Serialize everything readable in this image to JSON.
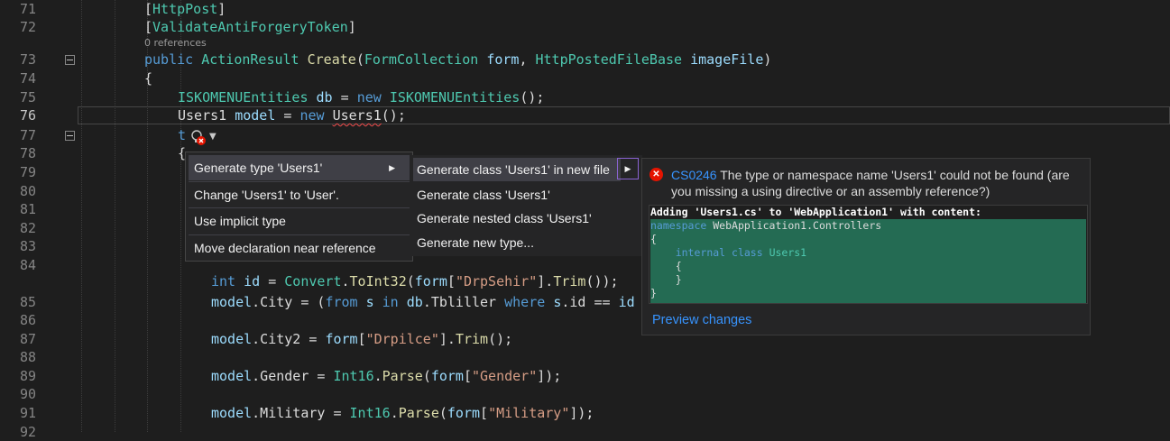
{
  "code_lines": [
    {
      "num": "71",
      "segments": [
        {
          "t": "[",
          "c": ""
        },
        {
          "t": "HttpPost",
          "c": "ty"
        },
        {
          "t": "]",
          "c": ""
        }
      ]
    },
    {
      "num": "72",
      "segments": [
        {
          "t": "[",
          "c": ""
        },
        {
          "t": "ValidateAntiForgeryToken",
          "c": "ty"
        },
        {
          "t": "]",
          "c": ""
        }
      ]
    },
    {
      "num": "73",
      "segments": [
        {
          "t": "public ",
          "c": "kw"
        },
        {
          "t": "ActionResult ",
          "c": "ty"
        },
        {
          "t": "Create",
          "c": "fn"
        },
        {
          "t": "(",
          "c": ""
        },
        {
          "t": "FormCollection ",
          "c": "ty"
        },
        {
          "t": "form",
          "c": "var"
        },
        {
          "t": ", ",
          "c": ""
        },
        {
          "t": "HttpPostedFileBase ",
          "c": "ty"
        },
        {
          "t": "imageFile",
          "c": "var"
        },
        {
          "t": ")",
          "c": ""
        }
      ]
    },
    {
      "num": "74",
      "segments": [
        {
          "t": "{",
          "c": ""
        }
      ]
    },
    {
      "num": "75",
      "segments": [
        {
          "t": "ISKOMENUEntities ",
          "c": "ty"
        },
        {
          "t": "db",
          "c": "var"
        },
        {
          "t": " = ",
          "c": ""
        },
        {
          "t": "new ",
          "c": "kw"
        },
        {
          "t": "ISKOMENUEntities",
          "c": "ty"
        },
        {
          "t": "();",
          "c": ""
        }
      ]
    },
    {
      "num": "76",
      "segments": [
        {
          "t": "Users1 ",
          "c": ""
        },
        {
          "t": "model",
          "c": "var"
        },
        {
          "t": " = ",
          "c": ""
        },
        {
          "t": "new ",
          "c": "kw"
        },
        {
          "t": "Users1",
          "c": "squig"
        },
        {
          "t": "();",
          "c": ""
        }
      ]
    },
    {
      "num": "77",
      "segments": [
        {
          "t": "t",
          "c": "kw"
        }
      ]
    },
    {
      "num": "78",
      "segments": [
        {
          "t": "{",
          "c": ""
        }
      ]
    },
    {
      "num": "79",
      "segments": []
    },
    {
      "num": "80",
      "segments": []
    },
    {
      "num": "81",
      "segments": []
    },
    {
      "num": "82",
      "segments": []
    },
    {
      "num": "83",
      "segments": []
    },
    {
      "num": "84",
      "segments": [
        {
          "t": "int ",
          "c": "kw"
        },
        {
          "t": "id",
          "c": "var"
        },
        {
          "t": " = ",
          "c": ""
        },
        {
          "t": "Convert",
          "c": "ty"
        },
        {
          "t": ".",
          "c": ""
        },
        {
          "t": "ToInt32",
          "c": "fn"
        },
        {
          "t": "(",
          "c": ""
        },
        {
          "t": "form",
          "c": "var"
        },
        {
          "t": "[",
          "c": ""
        },
        {
          "t": "\"DrpSehir\"",
          "c": "str"
        },
        {
          "t": "].",
          "c": ""
        },
        {
          "t": "Trim",
          "c": "fn"
        },
        {
          "t": "());",
          "c": ""
        }
      ]
    },
    {
      "num": "85",
      "segments": [
        {
          "t": "model",
          "c": "var"
        },
        {
          "t": ".City = (",
          "c": ""
        },
        {
          "t": "from ",
          "c": "kw"
        },
        {
          "t": "s ",
          "c": "var"
        },
        {
          "t": "in ",
          "c": "kw"
        },
        {
          "t": "db",
          "c": "var"
        },
        {
          "t": ".Tbliller ",
          "c": ""
        },
        {
          "t": "where ",
          "c": "kw"
        },
        {
          "t": "s",
          "c": "var"
        },
        {
          "t": ".id == ",
          "c": ""
        },
        {
          "t": "id",
          "c": "var"
        }
      ]
    },
    {
      "num": "86",
      "segments": []
    },
    {
      "num": "87",
      "segments": [
        {
          "t": "model",
          "c": "var"
        },
        {
          "t": ".City2 = ",
          "c": ""
        },
        {
          "t": "form",
          "c": "var"
        },
        {
          "t": "[",
          "c": ""
        },
        {
          "t": "\"Drpilce\"",
          "c": "str"
        },
        {
          "t": "].",
          "c": ""
        },
        {
          "t": "Trim",
          "c": "fn"
        },
        {
          "t": "();",
          "c": ""
        }
      ]
    },
    {
      "num": "88",
      "segments": []
    },
    {
      "num": "89",
      "segments": [
        {
          "t": "model",
          "c": "var"
        },
        {
          "t": ".Gender = ",
          "c": ""
        },
        {
          "t": "Int16",
          "c": "ty"
        },
        {
          "t": ".",
          "c": ""
        },
        {
          "t": "Parse",
          "c": "fn"
        },
        {
          "t": "(",
          "c": ""
        },
        {
          "t": "form",
          "c": "var"
        },
        {
          "t": "[",
          "c": ""
        },
        {
          "t": "\"Gender\"",
          "c": "str"
        },
        {
          "t": "]);",
          "c": ""
        }
      ]
    },
    {
      "num": "90",
      "segments": []
    },
    {
      "num": "91",
      "segments": [
        {
          "t": "model",
          "c": "var"
        },
        {
          "t": ".Military = ",
          "c": ""
        },
        {
          "t": "Int16",
          "c": "ty"
        },
        {
          "t": ".",
          "c": ""
        },
        {
          "t": "Parse",
          "c": "fn"
        },
        {
          "t": "(",
          "c": ""
        },
        {
          "t": "form",
          "c": "var"
        },
        {
          "t": "[",
          "c": ""
        },
        {
          "t": "\"Military\"",
          "c": "str"
        },
        {
          "t": "]);",
          "c": ""
        }
      ]
    },
    {
      "num": "92",
      "segments": []
    }
  ],
  "codelens": "0 references",
  "quick_actions": {
    "items": [
      "Generate type 'Users1'",
      "Change 'Users1' to 'User'.",
      "Use implicit type",
      "Move declaration near reference"
    ],
    "submenu": [
      "Generate class 'Users1' in new file",
      "Generate class 'Users1'",
      "Generate nested class 'Users1'",
      "Generate new type..."
    ]
  },
  "preview": {
    "error_code": "CS0246",
    "error_message": "The type or namespace name 'Users1' could not be found (are you missing a using directive or an assembly reference?)",
    "adding": "Adding 'Users1.cs' to 'WebApplication1' with content:",
    "lines": [
      [
        {
          "t": "namespace ",
          "c": "kw"
        },
        {
          "t": "WebApplication1.Controllers",
          "c": ""
        }
      ],
      [
        {
          "t": "{",
          "c": ""
        }
      ],
      [
        {
          "t": "    ",
          "c": ""
        },
        {
          "t": "internal class ",
          "c": "kw"
        },
        {
          "t": "Users1",
          "c": "ty"
        }
      ],
      [
        {
          "t": "    {",
          "c": ""
        }
      ],
      [
        {
          "t": "    }",
          "c": ""
        }
      ],
      [
        {
          "t": "}",
          "c": ""
        }
      ]
    ],
    "preview_changes_label": "Preview changes"
  }
}
